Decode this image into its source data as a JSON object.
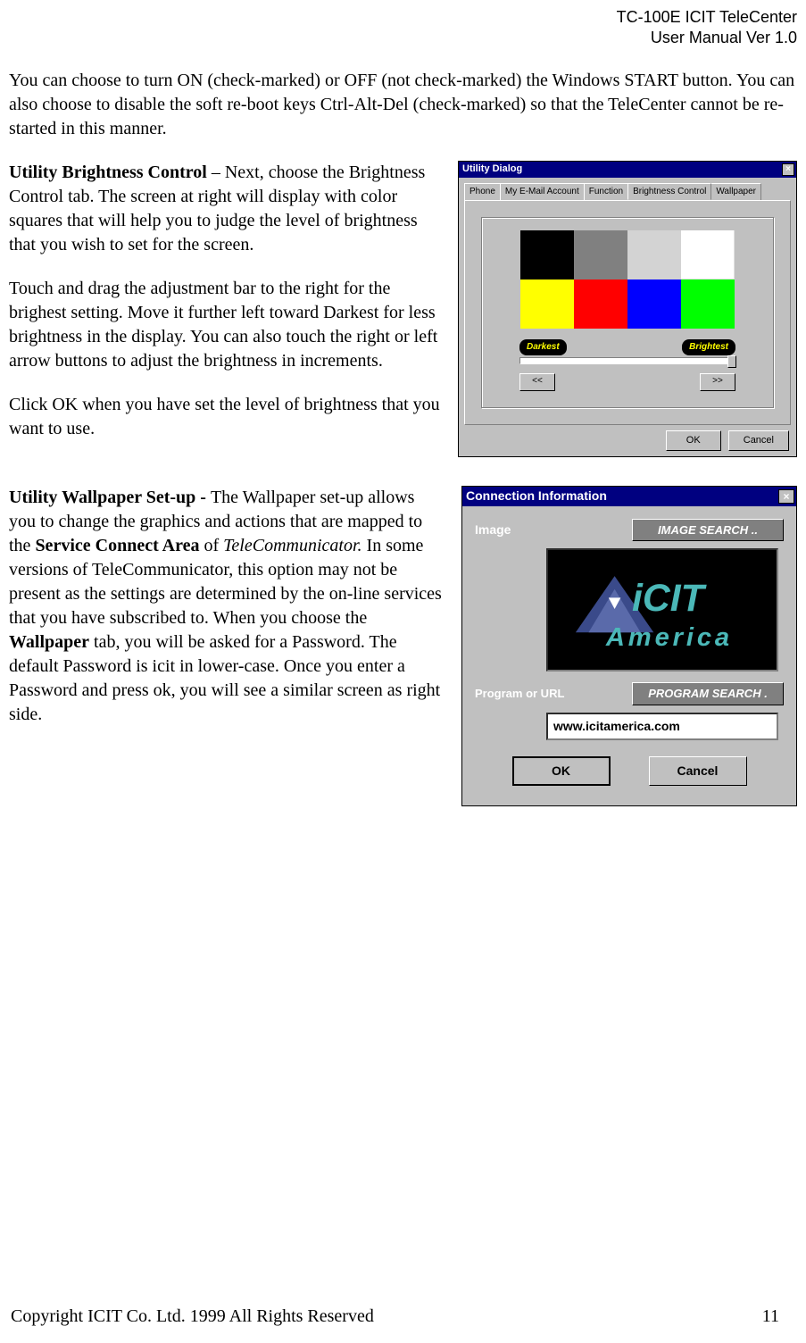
{
  "header": {
    "line1": "TC-100E ICIT TeleCenter",
    "line2": "User Manual  Ver 1.0"
  },
  "intro_para": "You can choose to turn ON (check-marked) or OFF (not check-marked) the Windows START button.  You can also choose to disable the soft re-boot keys Ctrl-Alt-Del (check-marked) so that the TeleCenter cannot be re-started  in this manner.",
  "brightness": {
    "heading": "Utility Brightness Control",
    "p1_after": " – Next, choose the Brightness Control tab. The screen at right will display with color squares that will help you to judge the level of brightness that you wish to set for the screen.",
    "p2": "Touch and drag the adjustment bar to the right for the brighest setting. Move it further left toward Darkest for less brightness in the display. You can also touch the right or left arrow buttons to adjust the brightness in increments.",
    "p3": "Click OK when you have set the level of brightness that you want to use."
  },
  "wallpaper": {
    "heading": "Utility Wallpaper  Set-up -  ",
    "p_prefix": "The Wallpaper set-up allows you to change the graphics and actions that are mapped to the ",
    "bold1": "Service Connect Area",
    "mid1": " of ",
    "italic1": "TeleCommunicator.",
    "mid2": " In some versions of TeleCommunicator, this option may not be present as the settings are determined by the on-line services that you have subscribed to. When you choose the ",
    "bold2": "Wallpaper",
    "suffix": " tab, you will be asked for a  Password. The default Password is icit in lower-case. Once you enter a Password and press ok, you will see a similar screen as right side."
  },
  "util_dialog": {
    "title": "Utility Dialog",
    "tabs": [
      "Phone",
      "My E-Mail Account",
      "Function",
      "Brightness Control",
      "Wallpaper"
    ],
    "active_tab": "Brightness Control",
    "darkest": "Darkest",
    "brightest": "Brightest",
    "left_arrow": "<<",
    "right_arrow": ">>",
    "ok": "OK",
    "cancel": "Cancel"
  },
  "conn_dialog": {
    "title": "Connection Information",
    "image_label": "Image",
    "image_search": "IMAGE SEARCH ..",
    "program_label": "Program or URL",
    "program_search": "PROGRAM SEARCH .",
    "url_value": "www.icitamerica.com",
    "ok": "OK",
    "cancel": "Cancel",
    "logo_top": "iCIT",
    "logo_bottom": "America"
  },
  "footer": {
    "copyright": "Copyright ICIT Co. Ltd. 1999  All Rights Reserved",
    "page": "11"
  }
}
